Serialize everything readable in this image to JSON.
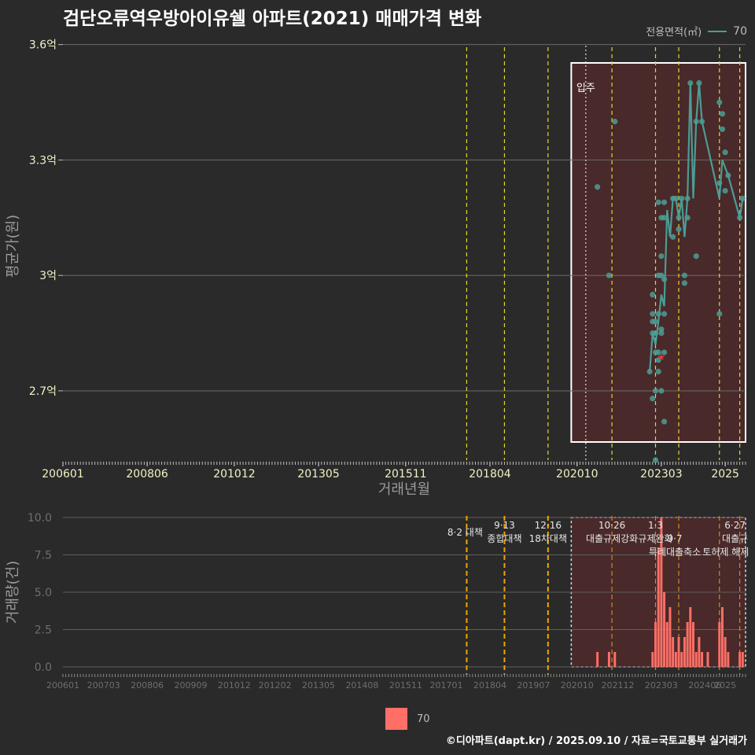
{
  "title": "검단오류역우방아이유쉘 아파트(2021) 매매가격 변화",
  "footer": "©디아파트(dapt.kr) / 2025.09.10 / 자료=국토교통부 실거래가",
  "legend_top": {
    "title": "전용면적(㎡)",
    "value": "70",
    "color": "#4a9d95"
  },
  "legend_bottom": {
    "value": "70",
    "color": "#ff6f66"
  },
  "colors": {
    "background": "#2a2a2b",
    "line": "#4a9d95",
    "bar": "#ff6f66",
    "policy_line": "#e6d52a",
    "policy_line_bottom": "#f0a500",
    "highlight_fill": "#5a2a2a"
  },
  "chart_data": [
    {
      "type": "line",
      "title": "검단오류역우방아이유쉘 아파트(2021) 매매가격 변화",
      "xlabel": "거래년월",
      "ylabel": "평균가(원)",
      "ylim": [
        2.52,
        3.63
      ],
      "ytick_values": [
        2.7,
        3.0,
        3.3,
        3.6
      ],
      "ytick_labels": [
        "2.7억",
        "3억",
        "3.3억",
        "3.6억"
      ],
      "xtick_labels": [
        "200601",
        "200806",
        "201012",
        "201305",
        "201511",
        "201804",
        "202010",
        "202303",
        "2025"
      ],
      "policy_months": [
        "2017-08",
        "2018-09",
        "2019-12",
        "2021-10",
        "2023-01",
        "2023-09",
        "2024-11",
        "2025-06"
      ],
      "annotation": {
        "label": "입주",
        "month": "2021-01"
      },
      "highlight_range": [
        "2020-08",
        "2025-08"
      ],
      "series": [
        {
          "name": "70",
          "points": [
            [
              "2021-05",
              3.23
            ],
            [
              "2021-09",
              3.0
            ],
            [
              "2021-11",
              3.4
            ],
            [
              "2022-11",
              2.75
            ],
            [
              "2022-12",
              2.85
            ],
            [
              "2022-12",
              2.68
            ],
            [
              "2022-12",
              2.9
            ],
            [
              "2022-12",
              2.95
            ],
            [
              "2023-01",
              2.85
            ],
            [
              "2023-01",
              2.8
            ],
            [
              "2023-01",
              2.7
            ],
            [
              "2023-01",
              2.88
            ],
            [
              "2023-02",
              2.75
            ],
            [
              "2023-02",
              2.9
            ],
            [
              "2023-02",
              3.0
            ],
            [
              "2023-02",
              3.19
            ],
            [
              "2023-02",
              2.78
            ],
            [
              "2023-03",
              2.7
            ],
            [
              "2023-03",
              3.05
            ],
            [
              "2023-03",
              3.15
            ],
            [
              "2023-03",
              2.85
            ],
            [
              "2023-03",
              3.0
            ],
            [
              "2023-04",
              3.19
            ],
            [
              "2023-04",
              3.15
            ],
            [
              "2023-04",
              2.9
            ],
            [
              "2023-04",
              2.99
            ],
            [
              "2023-04",
              2.62
            ],
            [
              "2023-04",
              2.8
            ],
            [
              "2022-12",
              2.88
            ],
            [
              "2023-01",
              2.52
            ],
            [
              "2023-02",
              2.8
            ],
            [
              "2023-03",
              2.86
            ],
            [
              "2023-07",
              3.1
            ],
            [
              "2023-07",
              3.2
            ],
            [
              "2023-08",
              3.2
            ],
            [
              "2023-09",
              3.15
            ],
            [
              "2023-09",
              3.12
            ],
            [
              "2023-10",
              3.2
            ],
            [
              "2023-11",
              3.0
            ],
            [
              "2023-11",
              2.98
            ],
            [
              "2023-12",
              3.15
            ],
            [
              "2023-12",
              3.2
            ],
            [
              "2024-01",
              3.5
            ],
            [
              "2024-03",
              3.05
            ],
            [
              "2024-03",
              3.4
            ],
            [
              "2024-04",
              3.5
            ],
            [
              "2024-05",
              3.4
            ],
            [
              "2024-11",
              2.9
            ],
            [
              "2024-11",
              3.24
            ],
            [
              "2024-11",
              3.45
            ],
            [
              "2024-12",
              3.42
            ],
            [
              "2024-12",
              3.38
            ],
            [
              "2025-01",
              3.22
            ],
            [
              "2025-01",
              3.32
            ],
            [
              "2025-02",
              3.26
            ],
            [
              "2025-06",
              3.15
            ],
            [
              "2025-07",
              3.2
            ]
          ],
          "mean_line": [
            [
              "2022-11",
              2.75
            ],
            [
              "2022-12",
              2.85
            ],
            [
              "2023-01",
              2.82
            ],
            [
              "2023-02",
              2.88
            ],
            [
              "2023-03",
              2.95
            ],
            [
              "2023-04",
              2.92
            ],
            [
              "2023-05",
              3.17
            ],
            [
              "2023-06",
              3.1
            ],
            [
              "2023-07",
              3.2
            ],
            [
              "2023-08",
              3.2
            ],
            [
              "2023-09",
              3.15
            ],
            [
              "2023-10",
              3.2
            ],
            [
              "2023-11",
              3.1
            ],
            [
              "2023-12",
              3.2
            ],
            [
              "2024-01",
              3.5
            ],
            [
              "2024-02",
              3.2
            ],
            [
              "2024-03",
              3.4
            ],
            [
              "2024-04",
              3.5
            ],
            [
              "2024-05",
              3.4
            ],
            [
              "2024-11",
              3.2
            ],
            [
              "2024-12",
              3.3
            ],
            [
              "2025-01",
              3.28
            ],
            [
              "2025-02",
              3.26
            ],
            [
              "2025-06",
              3.15
            ],
            [
              "2025-07",
              3.2
            ]
          ],
          "marker": {
            "label": "★",
            "month": "2023-03",
            "value": 2.79
          }
        }
      ]
    },
    {
      "type": "bar",
      "ylabel": "거래량(건)",
      "ylim": [
        0,
        10
      ],
      "ytick_values": [
        0,
        2.5,
        5,
        7.5,
        10
      ],
      "ytick_labels": [
        "0.0",
        "2.5",
        "5.0",
        "7.5",
        "10.0"
      ],
      "xtick_labels": [
        "200601",
        "200703",
        "200806",
        "200909",
        "201012",
        "201202",
        "201305",
        "201408",
        "201511",
        "201701",
        "201804",
        "201907",
        "202010",
        "202112",
        "202303",
        "202406",
        "2025"
      ],
      "policy_labels": [
        {
          "month": "2017-08",
          "lines": [
            "8·2 대책"
          ]
        },
        {
          "month": "2018-09",
          "lines": [
            "9·13",
            "종합대책"
          ]
        },
        {
          "month": "2019-12",
          "lines": [
            "12·16",
            "18차대책"
          ]
        },
        {
          "month": "2021-10",
          "lines": [
            "10·26",
            "대출규제강화"
          ]
        },
        {
          "month": "2023-01",
          "lines": [
            "1·3",
            "규제완화"
          ]
        },
        {
          "month": "2023-09",
          "lines": [
            "9·7",
            "특례대출축소"
          ]
        },
        {
          "month": "2024-11",
          "lines": [
            "",
            "토허제 해제"
          ]
        },
        {
          "month": "2025-06",
          "lines": [
            "6·27",
            "대출규"
          ]
        }
      ],
      "series": [
        {
          "name": "70",
          "points": [
            [
              "2021-05",
              1
            ],
            [
              "2021-09",
              1
            ],
            [
              "2021-11",
              1
            ],
            [
              "2022-12",
              1
            ],
            [
              "2023-01",
              3
            ],
            [
              "2023-02",
              8
            ],
            [
              "2023-03",
              10
            ],
            [
              "2023-04",
              5
            ],
            [
              "2023-05",
              3
            ],
            [
              "2023-06",
              4
            ],
            [
              "2023-07",
              2
            ],
            [
              "2023-08",
              1
            ],
            [
              "2023-09",
              2
            ],
            [
              "2023-10",
              1
            ],
            [
              "2023-11",
              2
            ],
            [
              "2023-12",
              3
            ],
            [
              "2024-01",
              4
            ],
            [
              "2024-02",
              3
            ],
            [
              "2024-03",
              1
            ],
            [
              "2024-04",
              2
            ],
            [
              "2024-05",
              1
            ],
            [
              "2024-07",
              1
            ],
            [
              "2024-11",
              3
            ],
            [
              "2024-12",
              4
            ],
            [
              "2025-01",
              2
            ],
            [
              "2025-02",
              1
            ],
            [
              "2025-06",
              1
            ],
            [
              "2025-07",
              1
            ]
          ]
        }
      ]
    }
  ]
}
